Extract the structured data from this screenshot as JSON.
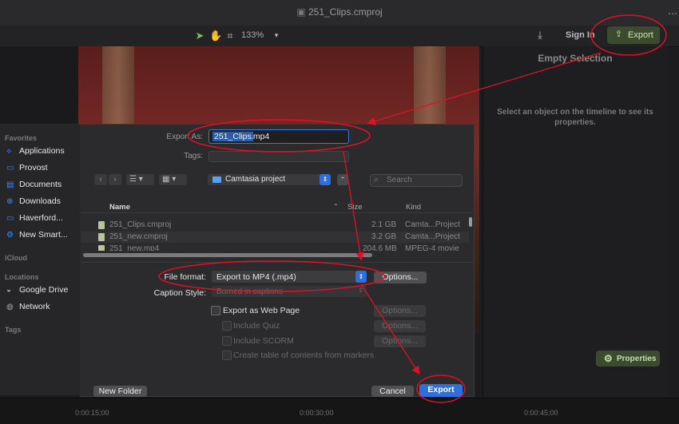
{
  "window": {
    "title": "251_Clips.cmproj"
  },
  "toolbar": {
    "zoom": "133%",
    "sign_in": "Sign In",
    "export": "Export"
  },
  "right_panel": {
    "title": "Empty Selection",
    "message": "Select an object on the timeline to see its properties.",
    "properties_button": "Properties"
  },
  "timeline": {
    "times": [
      "0:00:15;00",
      "0:00:30;00",
      "0:00:45;00"
    ]
  },
  "sidebar": {
    "favorites_header": "Favorites",
    "favorites": [
      {
        "label": "Applications",
        "icon": "applications-icon"
      },
      {
        "label": "Provost",
        "icon": "folder-icon"
      },
      {
        "label": "Documents",
        "icon": "document-icon"
      },
      {
        "label": "Downloads",
        "icon": "download-icon"
      },
      {
        "label": "Haverford...",
        "icon": "folder-icon"
      },
      {
        "label": "New Smart...",
        "icon": "gear-icon"
      }
    ],
    "icloud_header": "iCloud",
    "locations_header": "Locations",
    "locations": [
      {
        "label": "Google Drive",
        "icon": "drive-icon"
      },
      {
        "label": "Network",
        "icon": "globe-icon"
      }
    ],
    "tags_header": "Tags"
  },
  "dialog": {
    "export_as_label": "Export As:",
    "filename_selected": "251_Clips",
    "filename_ext": ".mp4",
    "tags_label": "Tags:",
    "location": "Camtasia project",
    "search_placeholder": "Search",
    "columns": {
      "name": "Name",
      "size": "Size",
      "kind": "Kind"
    },
    "files": [
      {
        "name": "251_Clips.cmproj",
        "size": "2.1 GB",
        "kind": "Camta...Project"
      },
      {
        "name": "251_new.cmproj",
        "size": "3.2 GB",
        "kind": "Camta...Project"
      },
      {
        "name": "251_new.mp4",
        "size": "204.6 MB",
        "kind": "MPEG-4 movie"
      }
    ],
    "file_format_label": "File format:",
    "file_format_value": "Export to MP4 (.mp4)",
    "options_label": "Options...",
    "caption_style_label": "Caption Style:",
    "caption_style_value": "Burned in captions",
    "web_page_label": "Export as Web Page",
    "include_quiz_label": "Include Quiz",
    "include_scorm_label": "Include SCORM",
    "toc_label": "Create table of contents from markers",
    "new_folder_label": "New Folder",
    "cancel_label": "Cancel",
    "export_label": "Export"
  },
  "colors": {
    "accent_blue": "#2f6fdc",
    "annotation_red": "#e0102a",
    "export_green": "#3c4a2f"
  }
}
